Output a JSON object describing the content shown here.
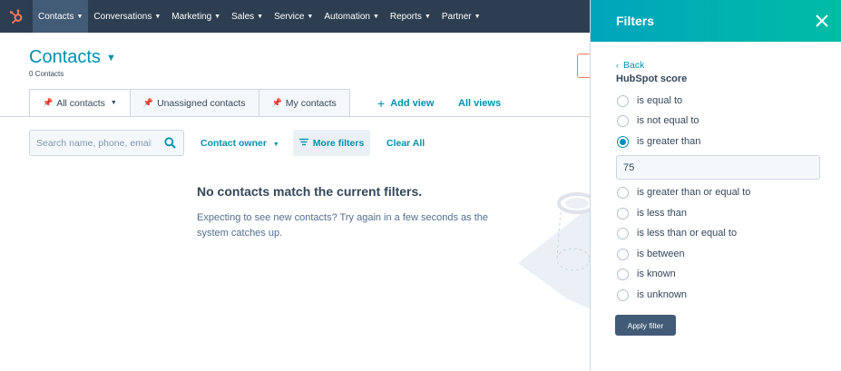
{
  "nav": {
    "items": [
      {
        "label": "Contacts",
        "active": true
      },
      {
        "label": "Conversations"
      },
      {
        "label": "Marketing"
      },
      {
        "label": "Sales"
      },
      {
        "label": "Service"
      },
      {
        "label": "Automation"
      },
      {
        "label": "Reports"
      },
      {
        "label": "Partner"
      }
    ]
  },
  "page": {
    "title": "Contacts",
    "count": "0 Contacts"
  },
  "tabs": [
    {
      "label": "All contacts"
    },
    {
      "label": "Unassigned contacts"
    },
    {
      "label": "My contacts"
    }
  ],
  "views": {
    "add_view": "Add view",
    "all_views": "All views"
  },
  "filters_bar": {
    "search_placeholder": "Search name, phone, email",
    "contact_owner": "Contact owner",
    "more_filters": "More filters",
    "clear_all": "Clear All"
  },
  "empty_state": {
    "title": "No contacts match the current filters.",
    "text": "Expecting to see new contacts? Try again in a few seconds as the system catches up."
  },
  "panel": {
    "title": "Filters",
    "back": "Back",
    "property": "HubSpot score",
    "options": [
      {
        "label": "is equal to",
        "checked": false
      },
      {
        "label": "is not equal to",
        "checked": false
      },
      {
        "label": "is greater than",
        "checked": true
      },
      {
        "label": "is greater than or equal to",
        "checked": false
      },
      {
        "label": "is less than",
        "checked": false
      },
      {
        "label": "is less than or equal to",
        "checked": false
      },
      {
        "label": "is between",
        "checked": false
      },
      {
        "label": "is known",
        "checked": false
      },
      {
        "label": "is unknown",
        "checked": false
      }
    ],
    "value": "75",
    "apply_label": "Apply filter"
  },
  "colors": {
    "nav_bg": "#2d3e50",
    "link": "#0091ae",
    "header_gradient_start": "#00a4bd",
    "header_gradient_end": "#00bda5",
    "button_dark": "#425b76",
    "logo": "#ff7a59"
  }
}
